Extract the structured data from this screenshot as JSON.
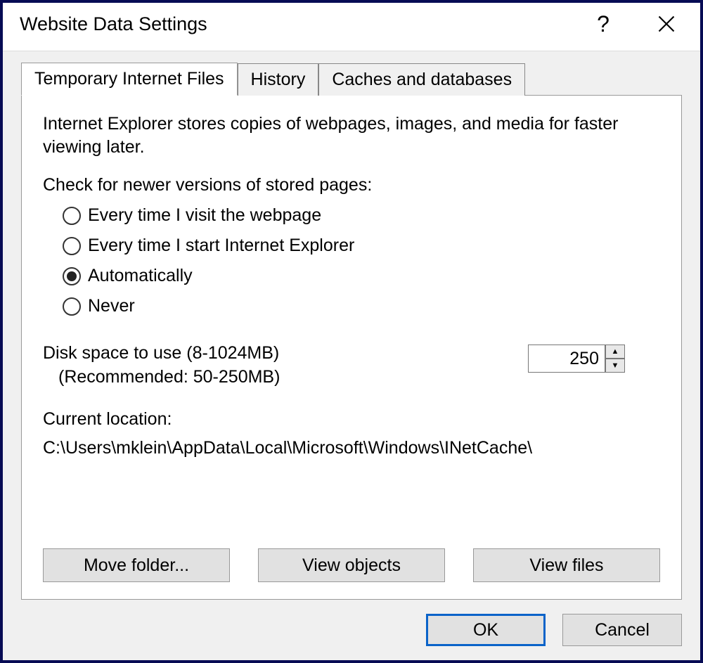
{
  "title": "Website Data Settings",
  "tabs": [
    {
      "label": "Temporary Internet Files",
      "active": true
    },
    {
      "label": "History",
      "active": false
    },
    {
      "label": "Caches and databases",
      "active": false
    }
  ],
  "panel": {
    "description": "Internet Explorer stores copies of webpages, images, and media for faster viewing later.",
    "check_label": "Check for newer versions of stored pages:",
    "radios": [
      {
        "label": "Every time I visit the webpage",
        "selected": false
      },
      {
        "label": "Every time I start Internet Explorer",
        "selected": false
      },
      {
        "label": "Automatically",
        "selected": true
      },
      {
        "label": "Never",
        "selected": false
      }
    ],
    "disk_label_line1": "Disk space to use (8-1024MB)",
    "disk_label_line2": "(Recommended: 50-250MB)",
    "disk_value": "250",
    "current_location_label": "Current location:",
    "current_location_path": "C:\\Users\\mklein\\AppData\\Local\\Microsoft\\Windows\\INetCache\\",
    "buttons": {
      "move_folder": "Move folder...",
      "view_objects": "View objects",
      "view_files": "View files"
    }
  },
  "dialog_buttons": {
    "ok": "OK",
    "cancel": "Cancel"
  },
  "icons": {
    "help": "?",
    "spin_up": "▲",
    "spin_down": "▼"
  }
}
